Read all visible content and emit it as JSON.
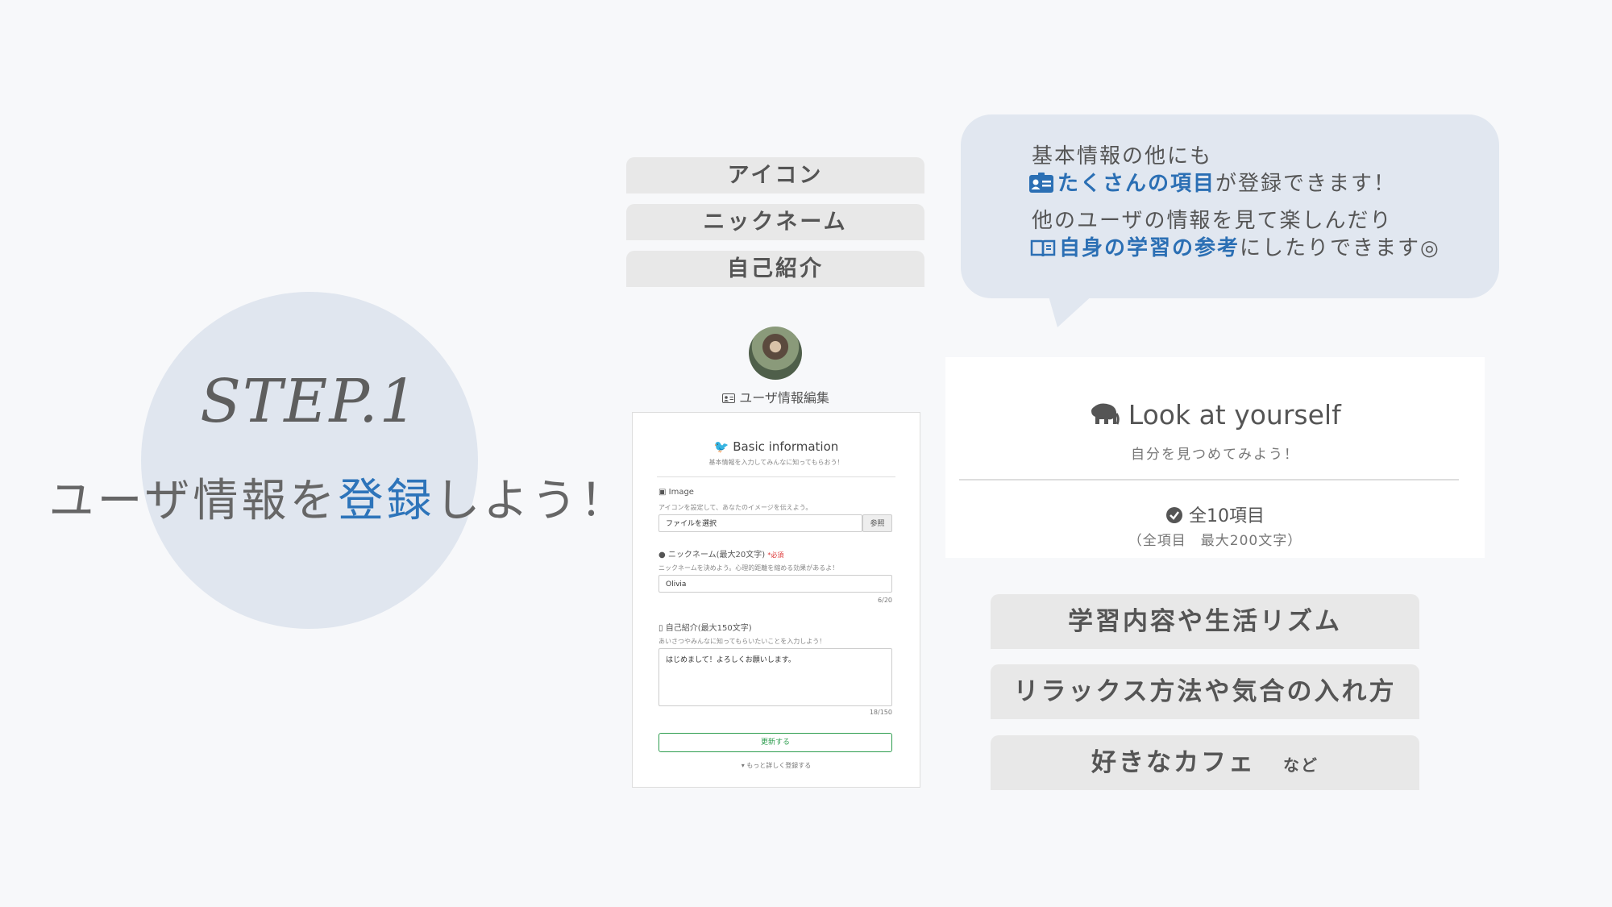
{
  "step": {
    "label": "STEP.1",
    "title_pre": "ユーザ情報を",
    "title_accent": "登録",
    "title_post": "しよう！"
  },
  "tags": [
    "アイコン",
    "ニックネーム",
    "自己紹介"
  ],
  "bubble": {
    "line1": "基本情報の他にも",
    "line2_hl": "たくさんの項目",
    "line2_rest": "が登録できます！",
    "line3": "他のユーザの情報を見て楽しんだり",
    "line4_hl": "自身の学習の参考",
    "line4_rest": "にしたりできます◎",
    "icon1": "id-card-icon",
    "icon2": "book-icon"
  },
  "form": {
    "heading": "ユーザ情報編集",
    "title": "Basic information",
    "subtitle": "基本情報を入力してみんなに知ってもらおう！",
    "image_label": "Image",
    "image_help": "アイコンを設定して、あなたのイメージを伝えよう。",
    "file_placeholder": "ファイルを選択",
    "browse": "参照",
    "nickname_label": "ニックネーム(最大20文字)",
    "required": "*必須",
    "nickname_help": "ニックネームを決めよう。心理的距離を縮める効果があるよ！",
    "nickname_value": "Olivia",
    "nickname_count": "6/20",
    "intro_label": "自己紹介(最大150文字)",
    "intro_help": "あいさつやみんなに知ってもらいたいことを入力しよう！",
    "intro_value": "はじめまして！よろしくお願いします。",
    "intro_count": "18/150",
    "submit": "更新する",
    "more": "▾ もっと詳しく登録する"
  },
  "look": {
    "title": "Look at yourself",
    "subtitle": "自分を見つめてみよう！",
    "count": "全10項目",
    "note": "（全項目　最大200文字）"
  },
  "examples": [
    "学習内容や生活リズム",
    "リラックス方法や気合の入れ方",
    "好きなカフェ"
  ],
  "examples_suffix": "など",
  "colors": {
    "accent": "#2d74ba",
    "bubble": "#e1e7f0",
    "circle": "#e0e6ef",
    "success": "#2e9d4f"
  }
}
